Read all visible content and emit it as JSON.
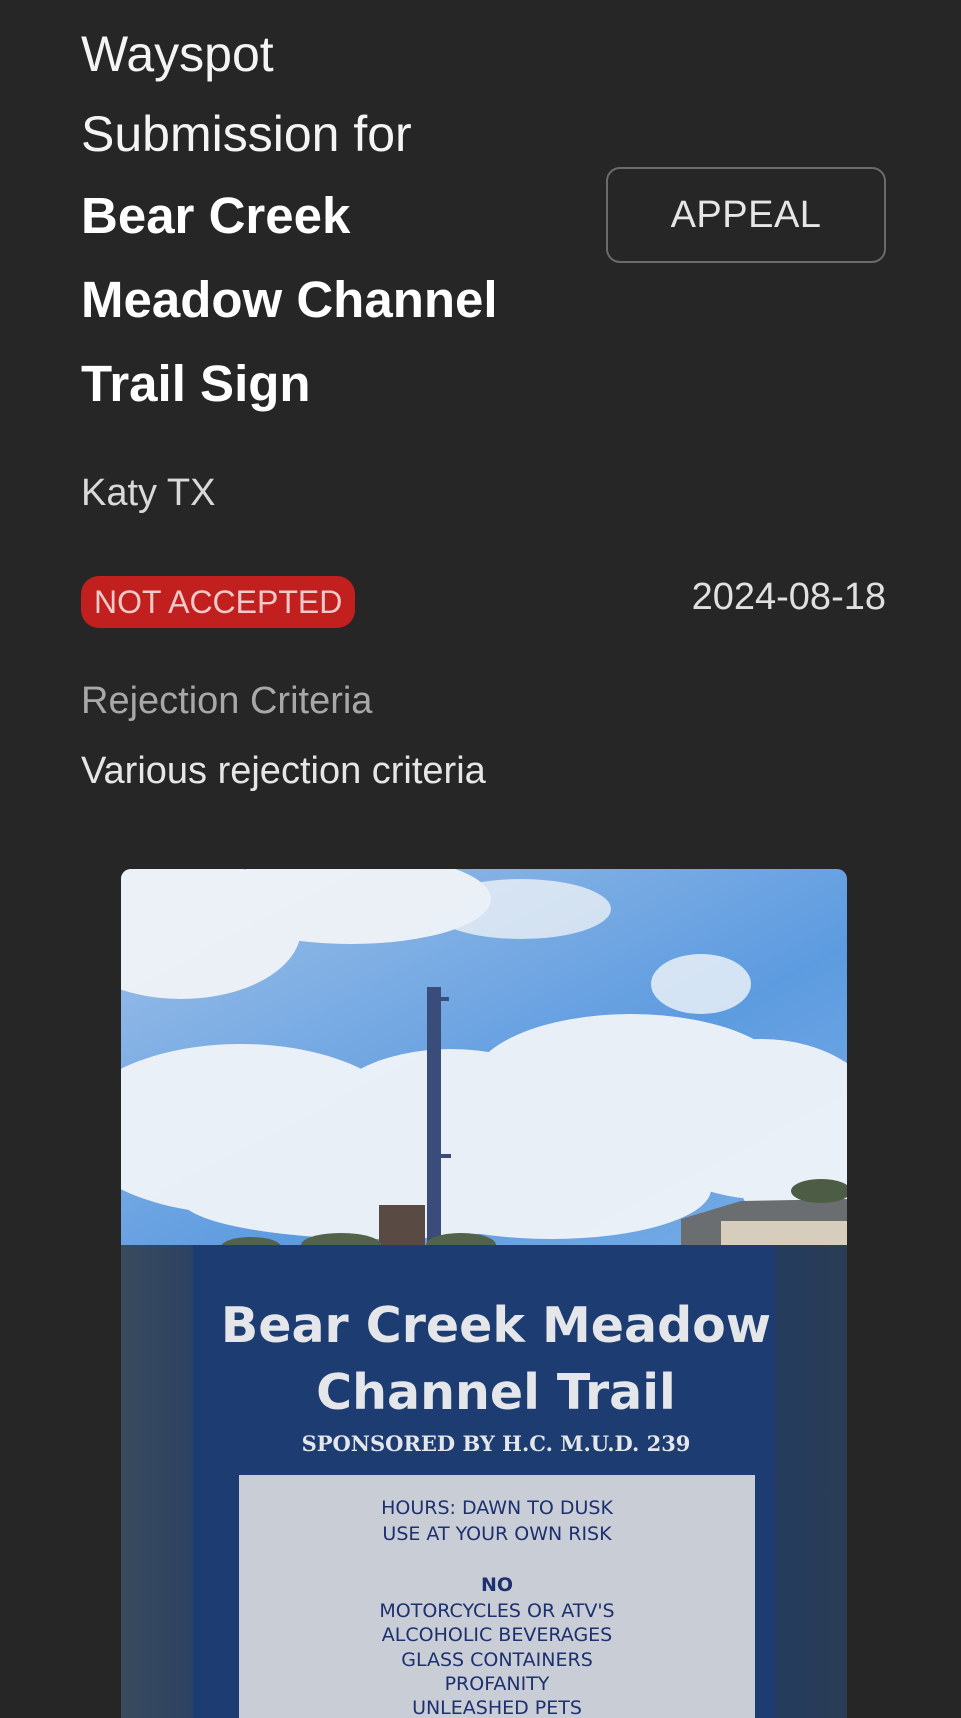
{
  "submission": {
    "title_prefix_line1": "Wayspot",
    "title_prefix_line2": "Submission for",
    "name_line1": "Bear Creek",
    "name_line2": "Meadow Channel",
    "name_line3": "Trail Sign",
    "location": "Katy TX",
    "status": "NOT ACCEPTED",
    "date": "2024-08-18",
    "rejection_label": "Rejection Criteria",
    "rejection_value": "Various rejection criteria"
  },
  "actions": {
    "appeal_label": "APPEAL"
  },
  "photo": {
    "sign_title_line1": "Bear Creek Meadow",
    "sign_title_line2": "Channel Trail",
    "sign_sponsor": "SPONSORED BY H.C. M.U.D. 239",
    "sign_rules": [
      "HOURS: DAWN TO DUSK",
      "USE AT YOUR OWN RISK",
      "NO",
      "MOTORCYCLES OR ATV'S",
      "ALCOHOLIC BEVERAGES",
      "GLASS CONTAINERS",
      "PROFANITY",
      "UNLEASHED PETS"
    ]
  },
  "colors": {
    "background": "#262626",
    "status_badge": "#c21f1f",
    "sign_blue": "#1d3f72"
  }
}
